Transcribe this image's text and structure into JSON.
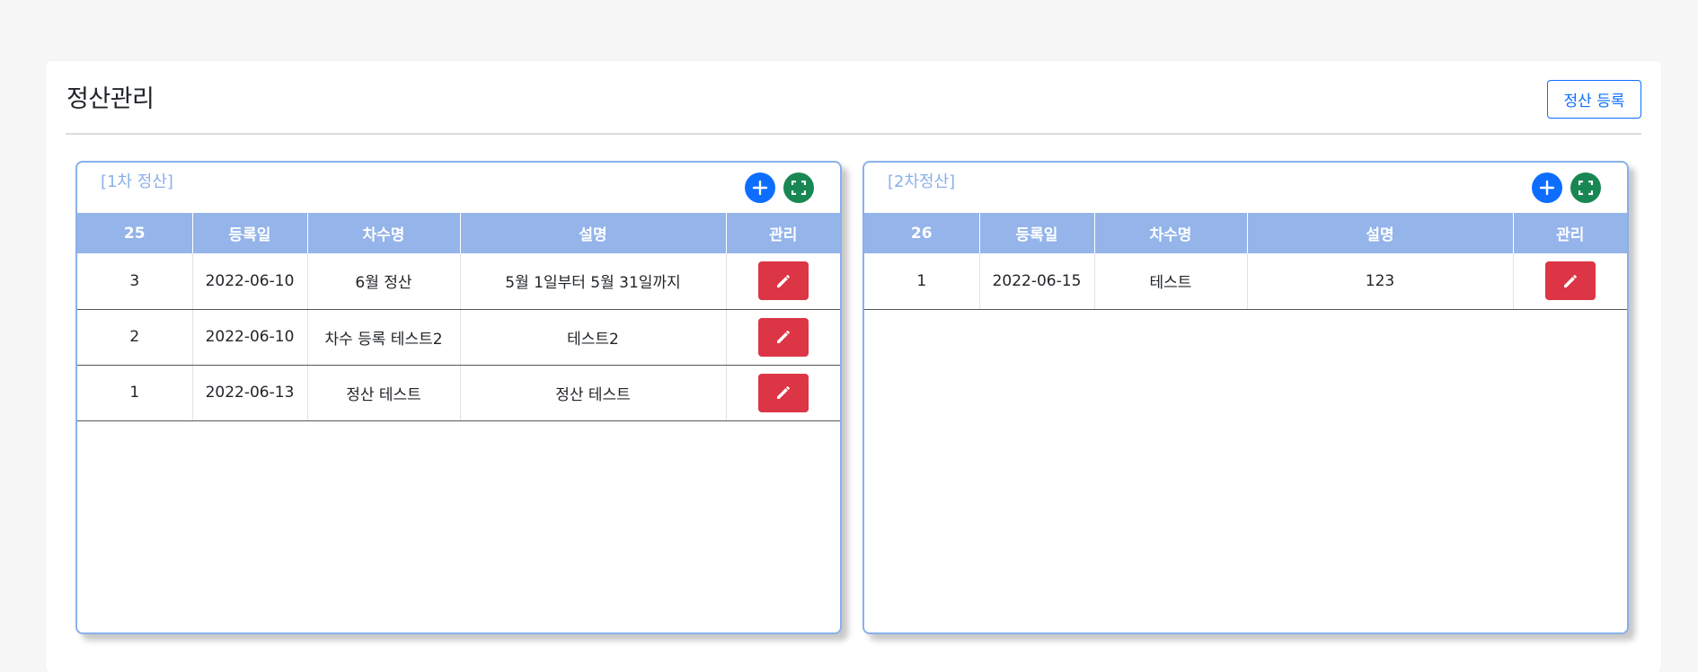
{
  "page": {
    "title": "정산관리",
    "register_button": "정산 등록"
  },
  "colors": {
    "accent_blue": "#0d6efd",
    "accent_green": "#198754",
    "danger_red": "#dc3545",
    "header_blue": "#94b4ea",
    "panel_border": "#8ab0ea"
  },
  "panels": [
    {
      "title": "[1차 정산]",
      "add_icon": "plus-icon",
      "expand_icon": "fullscreen-icon",
      "columns": [
        "25",
        "등록일",
        "차수명",
        "설명",
        "관리"
      ],
      "rows": [
        {
          "no": "3",
          "date": "2022-06-10",
          "name": "6월 정산",
          "desc": "5월 1일부터 5월 31일까지"
        },
        {
          "no": "2",
          "date": "2022-06-10",
          "name": "차수 등록 테스트2",
          "desc": "테스트2"
        },
        {
          "no": "1",
          "date": "2022-06-13",
          "name": "정산 테스트",
          "desc": "정산 테스트"
        }
      ]
    },
    {
      "title": "[2차정산]",
      "add_icon": "plus-icon",
      "expand_icon": "fullscreen-icon",
      "columns": [
        "26",
        "등록일",
        "차수명",
        "설명",
        "관리"
      ],
      "rows": [
        {
          "no": "1",
          "date": "2022-06-15",
          "name": "테스트",
          "desc": "123"
        }
      ]
    }
  ]
}
